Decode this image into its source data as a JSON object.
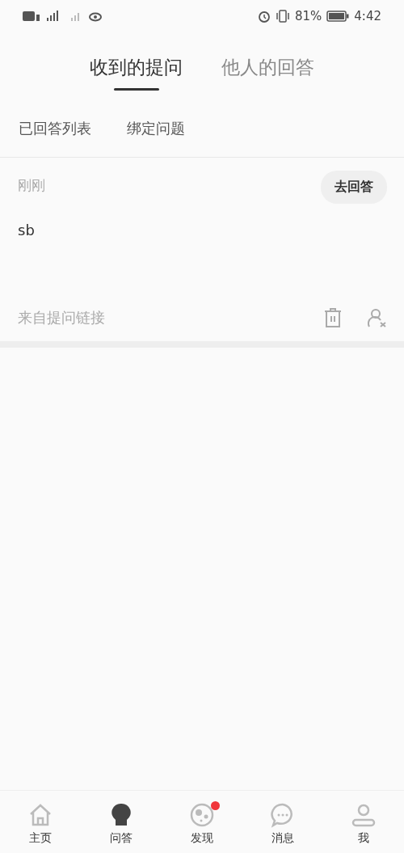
{
  "status_bar": {
    "battery": "81%",
    "time": "4:42"
  },
  "tabs": [
    {
      "label": "收到的提问",
      "selected": true
    },
    {
      "label": "他人的回答",
      "selected": false
    }
  ],
  "sub_tabs": [
    {
      "label": "已回答列表"
    },
    {
      "label": "绑定问题"
    }
  ],
  "questions": [
    {
      "time": "刚刚",
      "answer_button": "去回答",
      "text": "sb",
      "source": "来自提问链接"
    }
  ],
  "bottom_nav": [
    {
      "kind": "home",
      "label": "主页",
      "selected": false,
      "badge": false
    },
    {
      "kind": "qa",
      "label": "问答",
      "selected": true,
      "badge": false
    },
    {
      "kind": "discover",
      "label": "发现",
      "selected": false,
      "badge": true
    },
    {
      "kind": "messages",
      "label": "消息",
      "selected": false,
      "badge": false
    },
    {
      "kind": "me",
      "label": "我",
      "selected": false,
      "badge": false
    }
  ]
}
